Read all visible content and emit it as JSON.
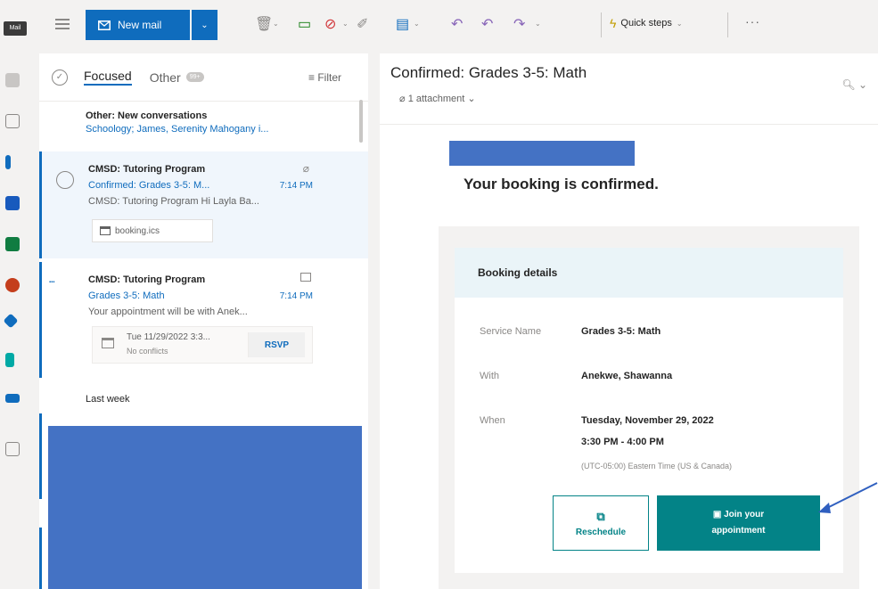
{
  "app": {
    "mail_tag": "Mail"
  },
  "toolbar": {
    "new_mail_label": "New mail",
    "quick_steps_label": "Quick steps",
    "more_label": "···"
  },
  "message_list": {
    "tabs": {
      "focused": "Focused",
      "other": "Other",
      "other_badge": "99+"
    },
    "filter_label": "Filter",
    "other_conversations": {
      "title": "Other: New conversations",
      "senders": "Schoology; James, Serenity Mahogany i..."
    },
    "items": [
      {
        "sender": "CMSD: Tutoring Program",
        "subject": "Confirmed: Grades 3-5: M...",
        "time": "7:14 PM",
        "preview": "CMSD: Tutoring Program Hi Layla Ba...",
        "attachment": "booking.ics"
      },
      {
        "sender": "CMSD: Tutoring Program",
        "subject": "Grades 3-5: Math",
        "time": "7:14 PM",
        "preview": "Your appointment will be with Anek...",
        "calendar": {
          "date": "Tue 11/29/2022 3:3...",
          "conflicts": "No conflicts",
          "rsvp_label": "RSVP"
        }
      }
    ],
    "section_last_week": "Last week"
  },
  "reading_pane": {
    "title": "Confirmed: Grades 3-5: Math",
    "attachment_count": "1 attachment",
    "heading": "Your booking is confirmed.",
    "card": {
      "header": "Booking details",
      "rows": [
        {
          "label": "Service Name",
          "value": "Grades 3-5: Math"
        },
        {
          "label": "With",
          "value": "Anekwe, Shawanna"
        },
        {
          "label": "When",
          "value": "Tuesday, November 29, 2022",
          "value2": "3:30 PM - 4:00 PM"
        }
      ],
      "timezone": "(UTC-05:00) Eastern Time (US & Canada)",
      "reschedule_label": "Reschedule",
      "join_label_line1": "Join your",
      "join_label_line2": "appointment"
    }
  },
  "colors": {
    "accent": "#0f6cbd",
    "teal": "#038387",
    "redaction": "#4472c4",
    "arrow": "#2f5fbf"
  }
}
